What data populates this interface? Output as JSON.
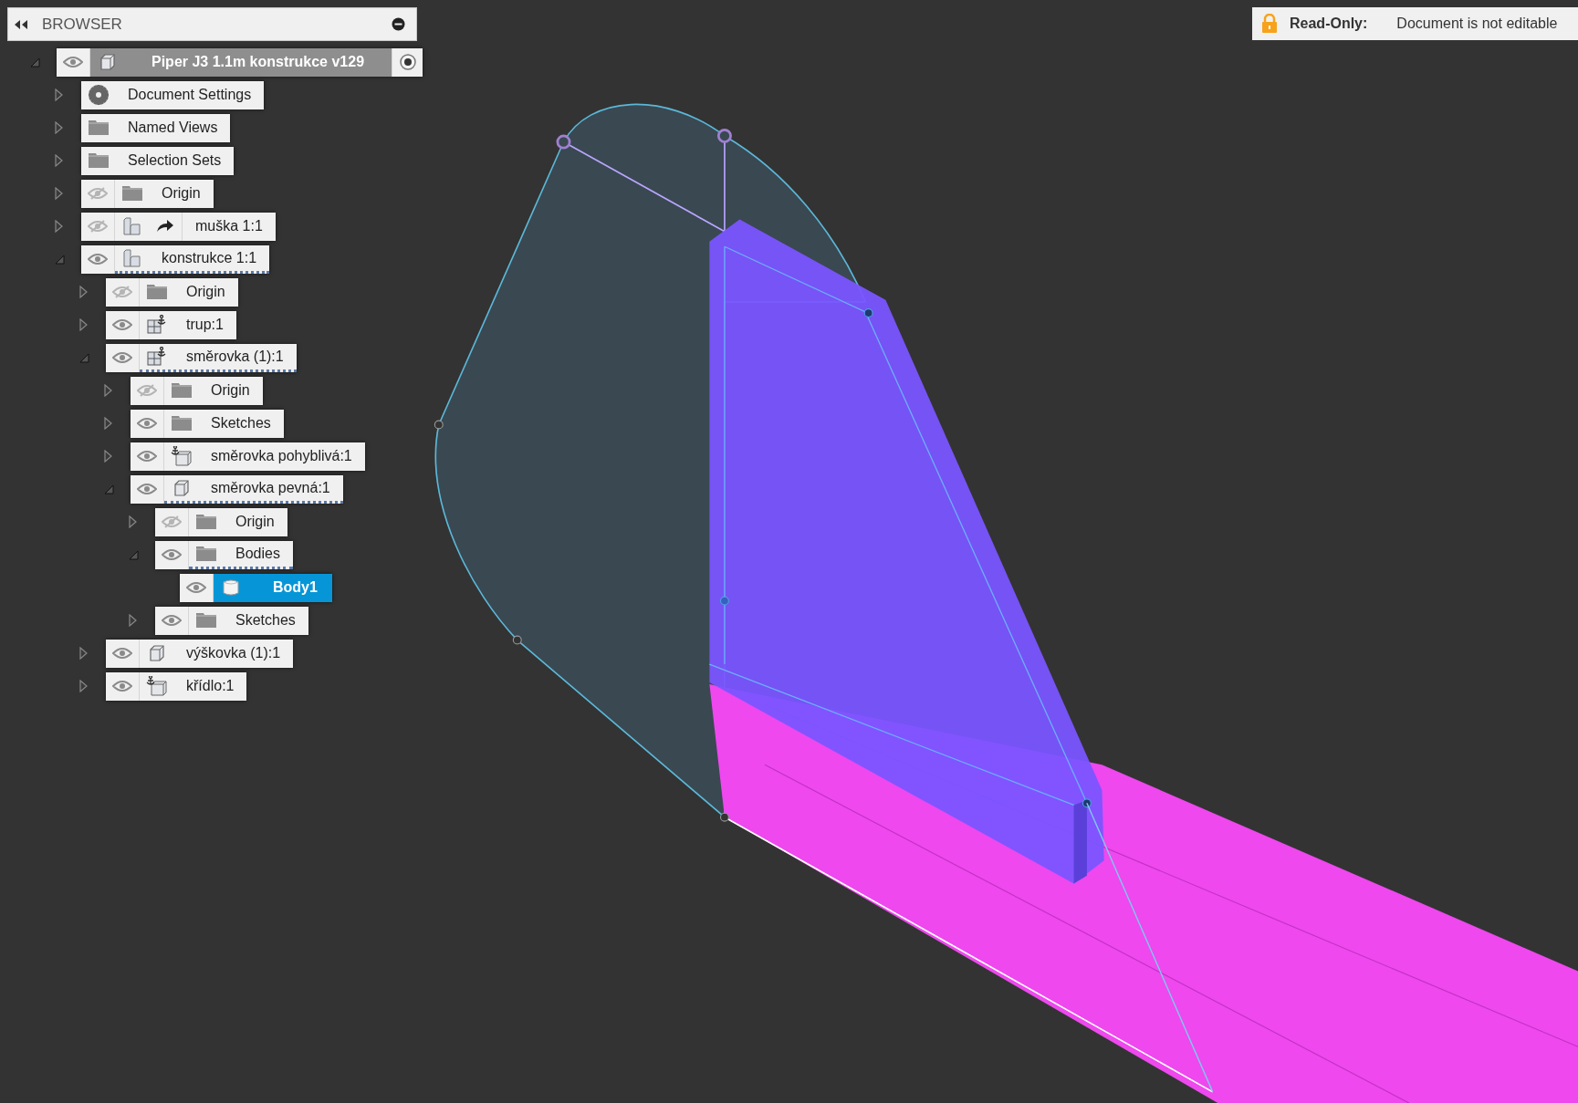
{
  "browser": {
    "title": "BROWSER"
  },
  "read_only": {
    "label": "Read-Only:",
    "message": "Document is not editable"
  },
  "tree": [
    {
      "label": "Piper J3 1.1m konstrukce v129",
      "kind": "document",
      "visible": true,
      "expanded": true,
      "active": true,
      "selected": false,
      "underlined": false,
      "children": [
        {
          "label": "Document Settings",
          "kind": "settings",
          "expanded": false,
          "selected": false,
          "underlined": false
        },
        {
          "label": "Named Views",
          "kind": "folder",
          "expanded": false,
          "selected": false,
          "underlined": false
        },
        {
          "label": "Selection Sets",
          "kind": "folder",
          "expanded": false,
          "selected": false,
          "underlined": false
        },
        {
          "label": "Origin",
          "kind": "folder",
          "visible": false,
          "expanded": false,
          "selected": false,
          "underlined": false
        },
        {
          "label": "muška 1:1",
          "kind": "component",
          "linked": true,
          "visible": false,
          "expanded": false,
          "selected": false,
          "underlined": false
        },
        {
          "label": "konstrukce 1:1",
          "kind": "component",
          "visible": true,
          "expanded": true,
          "selected": false,
          "underlined": true,
          "children": [
            {
              "label": "Origin",
              "kind": "folder",
              "visible": false,
              "expanded": false,
              "selected": false,
              "underlined": false
            },
            {
              "label": "trup:1",
              "kind": "assembly",
              "visible": true,
              "expanded": false,
              "selected": false,
              "underlined": false
            },
            {
              "label": "směrovka (1):1",
              "kind": "assembly",
              "visible": true,
              "expanded": true,
              "selected": false,
              "underlined": true,
              "children": [
                {
                  "label": "Origin",
                  "kind": "folder",
                  "visible": false,
                  "expanded": false,
                  "selected": false,
                  "underlined": false
                },
                {
                  "label": "Sketches",
                  "kind": "folder",
                  "visible": true,
                  "expanded": false,
                  "selected": false,
                  "underlined": false
                },
                {
                  "label": "směrovka pohyblivá:1",
                  "kind": "grounded",
                  "visible": true,
                  "expanded": false,
                  "selected": false,
                  "underlined": false
                },
                {
                  "label": "směrovka pevná:1",
                  "kind": "part",
                  "visible": true,
                  "expanded": true,
                  "selected": false,
                  "underlined": true,
                  "children": [
                    {
                      "label": "Origin",
                      "kind": "folder",
                      "visible": false,
                      "expanded": false,
                      "selected": false,
                      "underlined": false
                    },
                    {
                      "label": "Bodies",
                      "kind": "folder",
                      "visible": true,
                      "expanded": true,
                      "selected": false,
                      "underlined": true,
                      "children": [
                        {
                          "label": "Body1",
                          "kind": "body",
                          "visible": true,
                          "selected": true,
                          "underlined": false
                        }
                      ]
                    },
                    {
                      "label": "Sketches",
                      "kind": "folder",
                      "visible": true,
                      "expanded": false,
                      "selected": false,
                      "underlined": false
                    }
                  ]
                }
              ]
            },
            {
              "label": "výškovka (1):1",
              "kind": "part",
              "visible": true,
              "expanded": false,
              "selected": false,
              "underlined": false
            },
            {
              "label": "křídlo:1",
              "kind": "grounded",
              "visible": true,
              "expanded": false,
              "selected": false,
              "underlined": false
            }
          ]
        }
      ]
    }
  ]
}
